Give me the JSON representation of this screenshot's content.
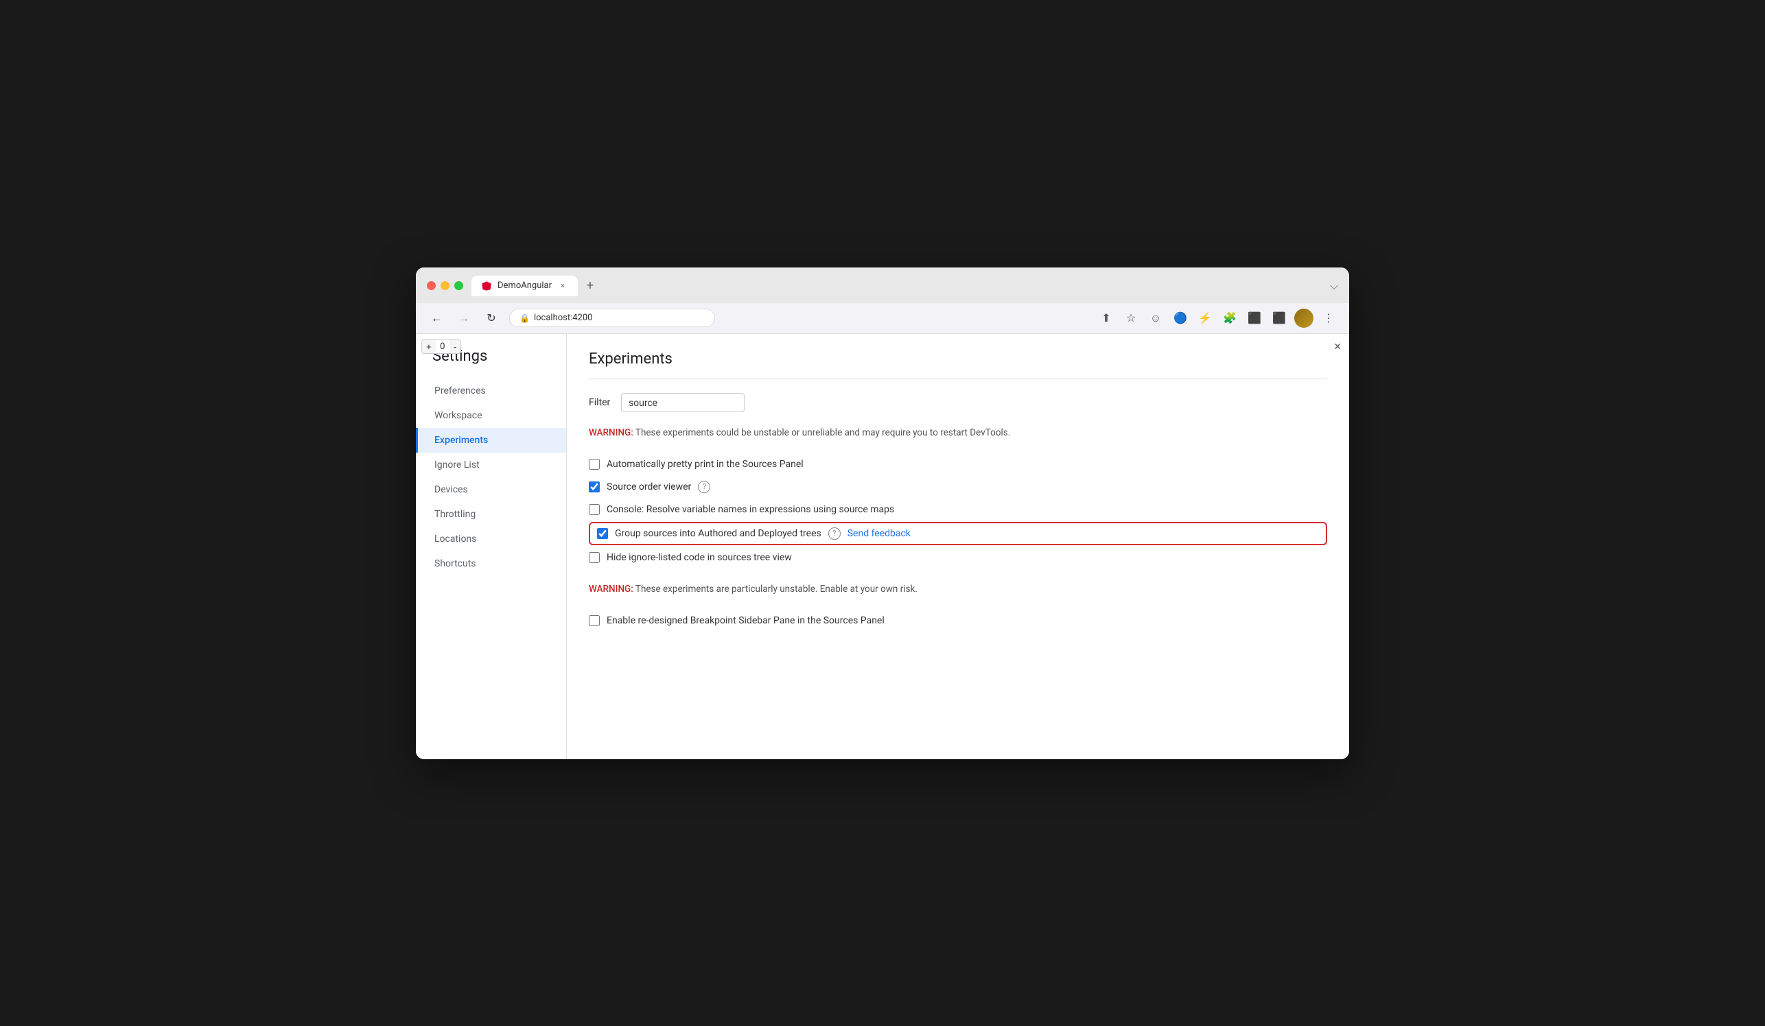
{
  "browser": {
    "traffic_lights": [
      "red",
      "yellow",
      "green"
    ],
    "tab": {
      "title": "DemoAngular",
      "close_label": "×",
      "new_tab_label": "+"
    },
    "nav": {
      "back_label": "←",
      "forward_label": "→",
      "reload_label": "↻",
      "address": "localhost:4200",
      "expand_label": "⌵"
    },
    "nav_actions": [
      "↑",
      "☆",
      "☺",
      "👾",
      "⚡",
      "🔌",
      "⬛",
      "⬛"
    ],
    "menu_label": "⋮"
  },
  "counter": {
    "minus": "-",
    "value": "0",
    "plus": "+"
  },
  "panel_close": "×",
  "settings": {
    "title": "Settings",
    "sidebar_items": [
      {
        "id": "preferences",
        "label": "Preferences",
        "active": false
      },
      {
        "id": "workspace",
        "label": "Workspace",
        "active": false
      },
      {
        "id": "experiments",
        "label": "Experiments",
        "active": true
      },
      {
        "id": "ignore-list",
        "label": "Ignore List",
        "active": false
      },
      {
        "id": "devices",
        "label": "Devices",
        "active": false
      },
      {
        "id": "throttling",
        "label": "Throttling",
        "active": false
      },
      {
        "id": "locations",
        "label": "Locations",
        "active": false
      },
      {
        "id": "shortcuts",
        "label": "Shortcuts",
        "active": false
      }
    ]
  },
  "experiments": {
    "title": "Experiments",
    "filter_label": "Filter",
    "filter_value": "source",
    "filter_placeholder": "Filter",
    "warning1": "WARNING:",
    "warning1_text": " These experiments could be unstable or unreliable and may require you to restart DevTools.",
    "items": [
      {
        "id": "pretty-print",
        "label": "Automatically pretty print in the Sources Panel",
        "checked": false,
        "highlighted": false,
        "has_help": false,
        "has_feedback": false
      },
      {
        "id": "source-order",
        "label": "Source order viewer",
        "checked": true,
        "highlighted": false,
        "has_help": true,
        "has_feedback": false
      },
      {
        "id": "console-resolve",
        "label": "Console: Resolve variable names in expressions using source maps",
        "checked": false,
        "highlighted": false,
        "has_help": false,
        "has_feedback": false
      },
      {
        "id": "group-sources",
        "label": "Group sources into Authored and Deployed trees",
        "checked": true,
        "highlighted": true,
        "has_help": true,
        "has_feedback": true,
        "feedback_label": "Send feedback"
      },
      {
        "id": "hide-ignore",
        "label": "Hide ignore-listed code in sources tree view",
        "checked": false,
        "highlighted": false,
        "has_help": false,
        "has_feedback": false
      }
    ],
    "warning2": "WARNING:",
    "warning2_text": " These experiments are particularly unstable. Enable at your own risk.",
    "unstable_items": [
      {
        "id": "breakpoint-sidebar",
        "label": "Enable re-designed Breakpoint Sidebar Pane in the Sources Panel",
        "checked": false
      }
    ]
  }
}
